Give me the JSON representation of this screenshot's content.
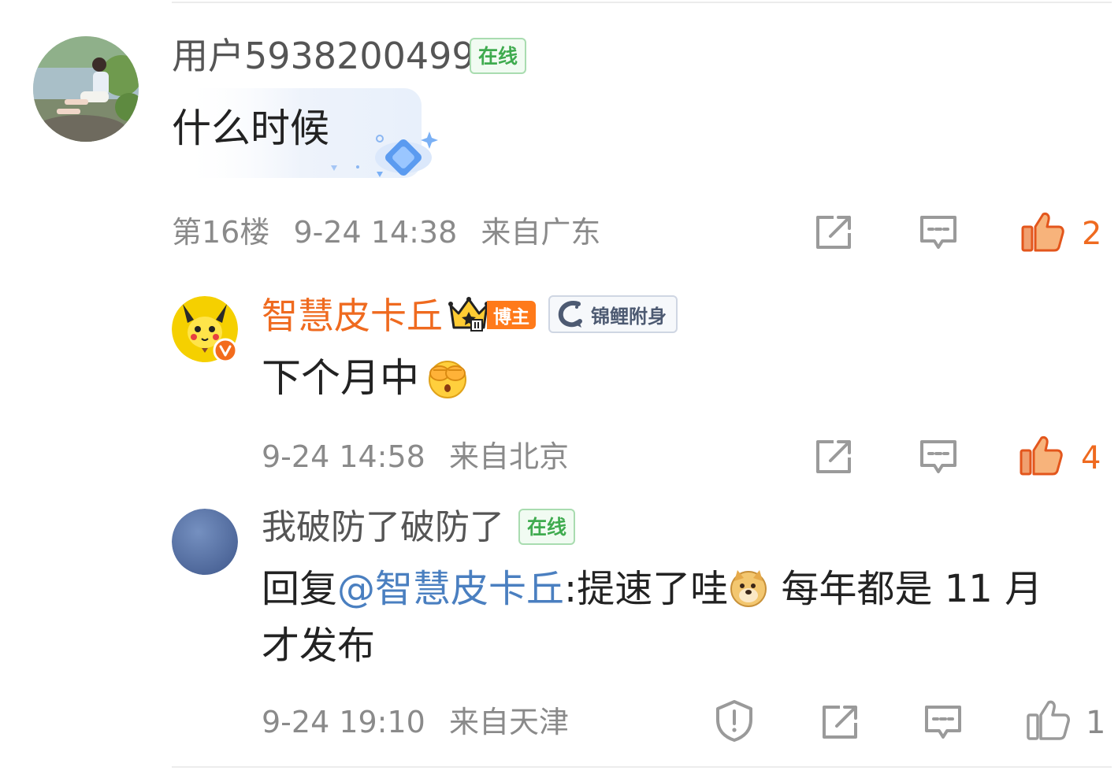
{
  "comments": [
    {
      "username": "用户5938200499",
      "online_badge": "在线",
      "text": "什么时候",
      "floor": "第16楼",
      "time": "9-24 14:38",
      "location": "来自广东",
      "like_count": "2"
    },
    {
      "username": "智慧皮卡丘",
      "username_color": "#ef6a1f",
      "blogger_badge": "博主",
      "koi_badge": "锦鲤附身",
      "text": "下个月中",
      "emoji": "covering-face-emoji",
      "time": "9-24 14:58",
      "location": "来自北京",
      "like_count": "4"
    },
    {
      "username": "我破防了破防了",
      "online_badge": "在线",
      "reply_prefix": "回复",
      "mention": "@智慧皮卡丘",
      "text_part1": ":提速了哇",
      "emoji": "doge-emoji",
      "text_part2": " 每年都是 11 月",
      "text_line2": "才发布",
      "time": "9-24 19:10",
      "location": "来自天津",
      "like_count": "1"
    }
  ],
  "colors": {
    "accent_orange": "#ef6a1f",
    "online_green": "#3fab4f",
    "mention_blue": "#4a7fc0",
    "meta_gray": "#8a8a8a"
  },
  "icons": [
    "share-icon",
    "reply-icon",
    "like-icon",
    "report-icon"
  ]
}
